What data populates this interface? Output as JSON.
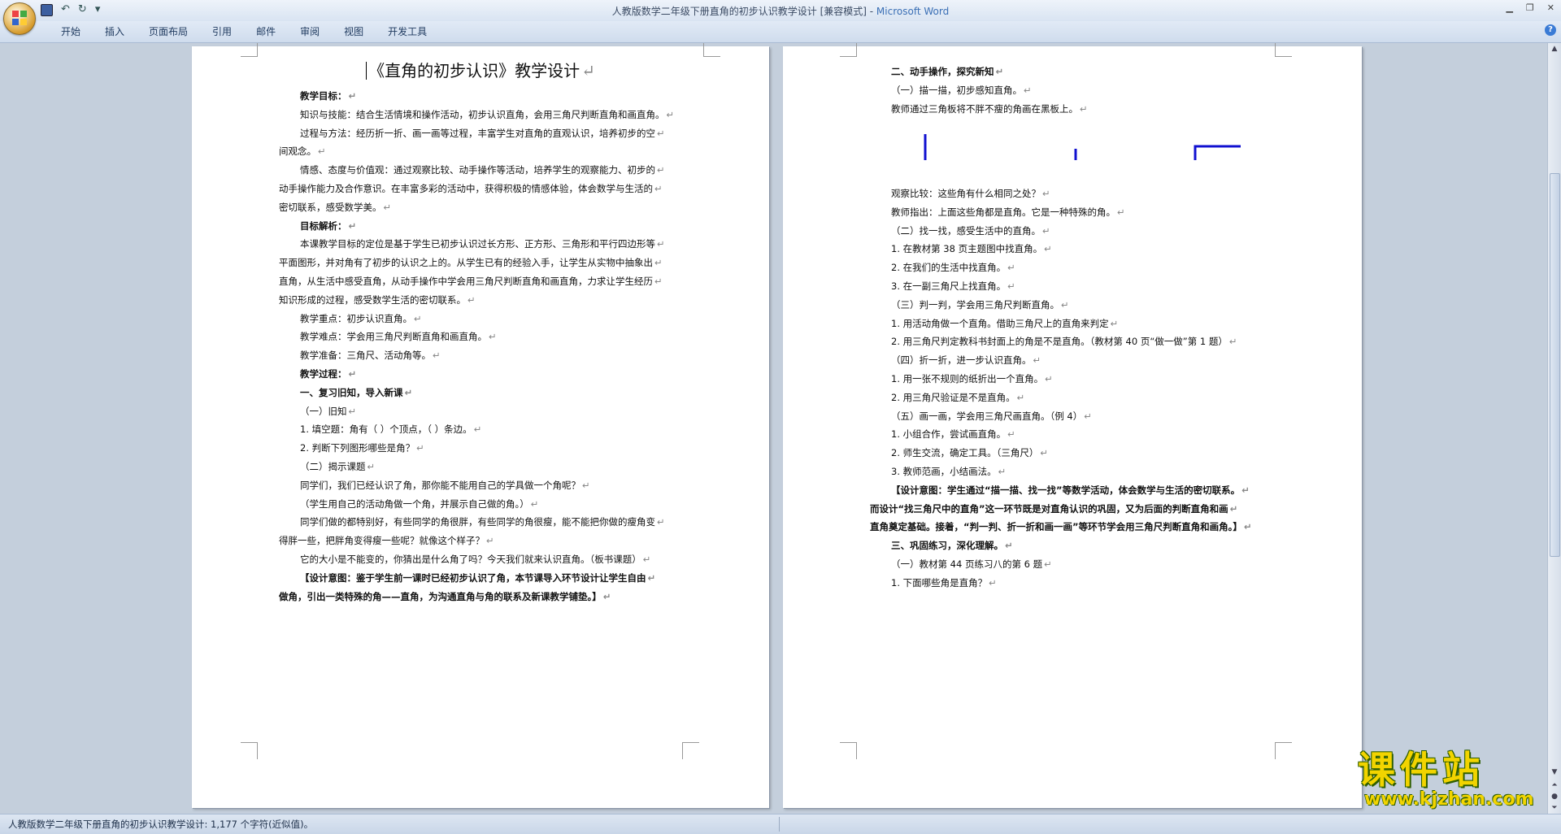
{
  "window": {
    "title": "人教版数学二年级下册直角的初步认识教学设计 [兼容模式] - ",
    "app_name": "Microsoft Word",
    "controls": [
      "▁",
      "❐",
      "✕"
    ]
  },
  "ribbon": {
    "tabs": [
      "开始",
      "插入",
      "页面布局",
      "引用",
      "邮件",
      "审阅",
      "视图",
      "开发工具"
    ]
  },
  "page1": {
    "title": "《直角的初步认识》教学设计",
    "lines": [
      {
        "text": "教学目标：",
        "bold": true
      },
      {
        "text": "知识与技能：结合生活情境和操作活动，初步认识直角，会用三角尺判断直角和画直角。",
        "bold": false
      },
      {
        "text": "过程与方法：经历折一折、画一画等过程，丰富学生对直角的直观认识，培养初步的空",
        "bold": false
      },
      {
        "text": "间观念。",
        "bold": false
      },
      {
        "text": "情感、态度与价值观：通过观察比较、动手操作等活动，培养学生的观察能力、初步的",
        "bold": false
      },
      {
        "text": "动手操作能力及合作意识。在丰富多彩的活动中，获得积极的情感体验，体会数学与生活的",
        "bold": false
      },
      {
        "text": "密切联系，感受数学美。",
        "bold": false
      },
      {
        "text": "目标解析：",
        "bold": true
      },
      {
        "text": "本课教学目标的定位是基于学生已初步认识过长方形、正方形、三角形和平行四边形等",
        "bold": false
      },
      {
        "text": "平面图形，并对角有了初步的认识之上的。从学生已有的经验入手，让学生从实物中抽象出",
        "bold": false
      },
      {
        "text": "直角，从生活中感受直角，从动手操作中学会用三角尺判断直角和画直角，力求让学生经历",
        "bold": false
      },
      {
        "text": "知识形成的过程，感受数学生活的密切联系。",
        "bold": false
      },
      {
        "text": "教学重点：初步认识直角。",
        "bold": false
      },
      {
        "text": "教学难点：学会用三角尺判断直角和画直角。",
        "bold": false
      },
      {
        "text": "教学准备：三角尺、活动角等。",
        "bold": false
      },
      {
        "text": "教学过程：",
        "bold": true
      },
      {
        "text": "一、复习旧知，导入新课",
        "bold": true
      },
      {
        "text": "（一）旧知",
        "bold": false
      },
      {
        "text": "1. 填空题：角有（    ）个顶点，（    ）条边。",
        "bold": false
      },
      {
        "text": "2. 判断下列图形哪些是角？",
        "bold": false
      },
      {
        "text": "（二）揭示课题",
        "bold": false
      },
      {
        "text": "同学们，我们已经认识了角，那你能不能用自己的学具做一个角呢？",
        "bold": false
      },
      {
        "text": "（学生用自己的活动角做一个角，并展示自己做的角。）",
        "bold": false
      },
      {
        "text": "同学们做的都特别好，有些同学的角很胖，有些同学的角很瘦，能不能把你做的瘦角变",
        "bold": false
      },
      {
        "text": "得胖一些，把胖角变得瘦一些呢？就像这个样子？",
        "bold": false
      },
      {
        "text": "它的大小是不能变的，你猜出是什么角了吗？今天我们就来认识直角。（板书课题）",
        "bold": false
      },
      {
        "text": "【设计意图：鉴于学生前一课时已经初步认识了角，本节课导入环节设计让学生自由",
        "bold": true
      },
      {
        "text": "做角，引出一类特殊的角——直角，为沟通直角与角的联系及新课教学铺垫。】",
        "bold": true
      }
    ]
  },
  "page2": {
    "lines_top": [
      {
        "text": "二、动手操作，探究新知",
        "bold": true
      },
      {
        "text": "（一）描一描，初步感知直角。",
        "bold": false
      },
      {
        "text": "教师通过三角板将不胖不瘦的角画在黑板上。",
        "bold": false
      }
    ],
    "lines": [
      {
        "text": "观察比较：这些角有什么相同之处？",
        "bold": false
      },
      {
        "text": "教师指出：上面这些角都是直角。它是一种特殊的角。",
        "bold": false
      },
      {
        "text": "（二）找一找，感受生活中的直角。",
        "bold": false
      },
      {
        "text": "1. 在教材第 38 页主题图中找直角。",
        "bold": false
      },
      {
        "text": "2. 在我们的生活中找直角。",
        "bold": false
      },
      {
        "text": "3. 在一副三角尺上找直角。",
        "bold": false
      },
      {
        "text": "（三）判一判，学会用三角尺判断直角。",
        "bold": false
      },
      {
        "text": "1. 用活动角做一个直角。借助三角尺上的直角来判定",
        "bold": false
      },
      {
        "text": "2. 用三角尺判定教科书封面上的角是不是直角。（教材第 40 页“做一做”第 1 题）",
        "bold": false
      },
      {
        "text": "（四）折一折，进一步认识直角。",
        "bold": false
      },
      {
        "text": "1. 用一张不规则的纸折出一个直角。",
        "bold": false
      },
      {
        "text": "2. 用三角尺验证是不是直角。",
        "bold": false
      },
      {
        "text": "（五）画一画，学会用三角尺画直角。（例 4）",
        "bold": false
      },
      {
        "text": "1. 小组合作，尝试画直角。",
        "bold": false
      },
      {
        "text": "2. 师生交流，确定工具。（三角尺）",
        "bold": false
      },
      {
        "text": "3. 教师范画，小结画法。",
        "bold": false
      },
      {
        "text": "【设计意图：学生通过“描一描、找一找”等数学活动，体会数学与生活的密切联系。",
        "bold": true
      },
      {
        "text": "而设计“找三角尺中的直角”这一环节既是对直角认识的巩固，又为后面的判断直角和画",
        "bold": true
      },
      {
        "text": "直角奠定基础。接着，“判一判、折一折和画一画”等环节学会用三角尺判断直角和画角。】",
        "bold": true
      },
      {
        "text": "三、巩固练习，深化理解。",
        "bold": true
      },
      {
        "text": "（一）教材第 44 页练习八的第 6 题",
        "bold": false
      },
      {
        "text": "1. 下面哪些角是直角？",
        "bold": false
      }
    ]
  },
  "status": {
    "text": "人教版数学二年级下册直角的初步认识教学设计: 1,177 个字符(近似值)。"
  },
  "watermark": {
    "title": "课件站",
    "url": "www.kjzhan.com"
  },
  "colors": {
    "angle_stroke": "#1010d0",
    "watermark_yellow": "#f2d400",
    "workspace": "#c4cfdc"
  }
}
